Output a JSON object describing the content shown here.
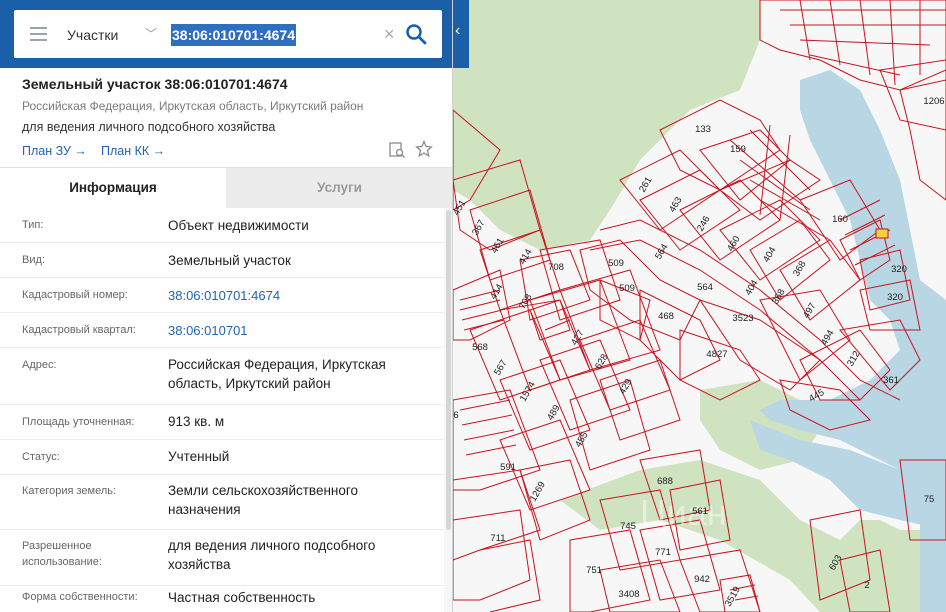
{
  "search": {
    "layer": "Участки",
    "query": "38:06:010701:4674"
  },
  "object": {
    "title": "Земельный участок 38:06:010701:4674",
    "region": "Российская Федерация, Иркутская область, Иркутский район",
    "use": "для ведения личного подсобного хозяйства",
    "links": [
      "План ЗУ →",
      "План КК →"
    ]
  },
  "tabs": [
    "Информация",
    "Услуги"
  ],
  "info": [
    {
      "label": "Тип:",
      "value": "Объект недвижимости"
    },
    {
      "label": "Вид:",
      "value": "Земельный участок"
    },
    {
      "label": "Кадастровый номер:",
      "value": "38:06:010701:4674"
    },
    {
      "label": "Кадастровый квартал:",
      "value": "38:06:010701"
    },
    {
      "label": "Адрес:",
      "value": "Российская Федерация, Иркутская область, Иркутский район"
    },
    {
      "label": "Площадь уточненная:",
      "value": "913 кв. м"
    },
    {
      "label": "Статус:",
      "value": "Учтенный"
    },
    {
      "label": "Категория земель:",
      "value": "Земли сельскохозяйственного назначения"
    },
    {
      "label": "Разрешенное использование:",
      "value": "для ведения личного подсобного хозяйства"
    },
    {
      "label": "Форма собственности:",
      "value": "Частная собственность"
    }
  ],
  "map": {
    "parcel_labels": [
      "133",
      "159",
      "261",
      "463",
      "246",
      "460",
      "404",
      "368",
      "160",
      "320",
      "320",
      "1206",
      "451",
      "367",
      "461",
      "414",
      "414",
      "708",
      "708",
      "509",
      "509",
      "564",
      "564",
      "404",
      "368",
      "497",
      "494",
      "312",
      "361",
      "3523",
      "468",
      "4827",
      "445",
      "568",
      "567",
      "1574",
      "427",
      "628",
      "429",
      "489",
      "455",
      "591",
      "1269",
      "711",
      "688",
      "561",
      "745",
      "771",
      "751",
      "942",
      "3408",
      "3519",
      "603",
      "2",
      "75",
      "6"
    ],
    "colors": {
      "parcel": "#c8141e",
      "forest": "#cfe3c0",
      "water": "#b8d6e3",
      "selected": "#f5d23a"
    }
  }
}
